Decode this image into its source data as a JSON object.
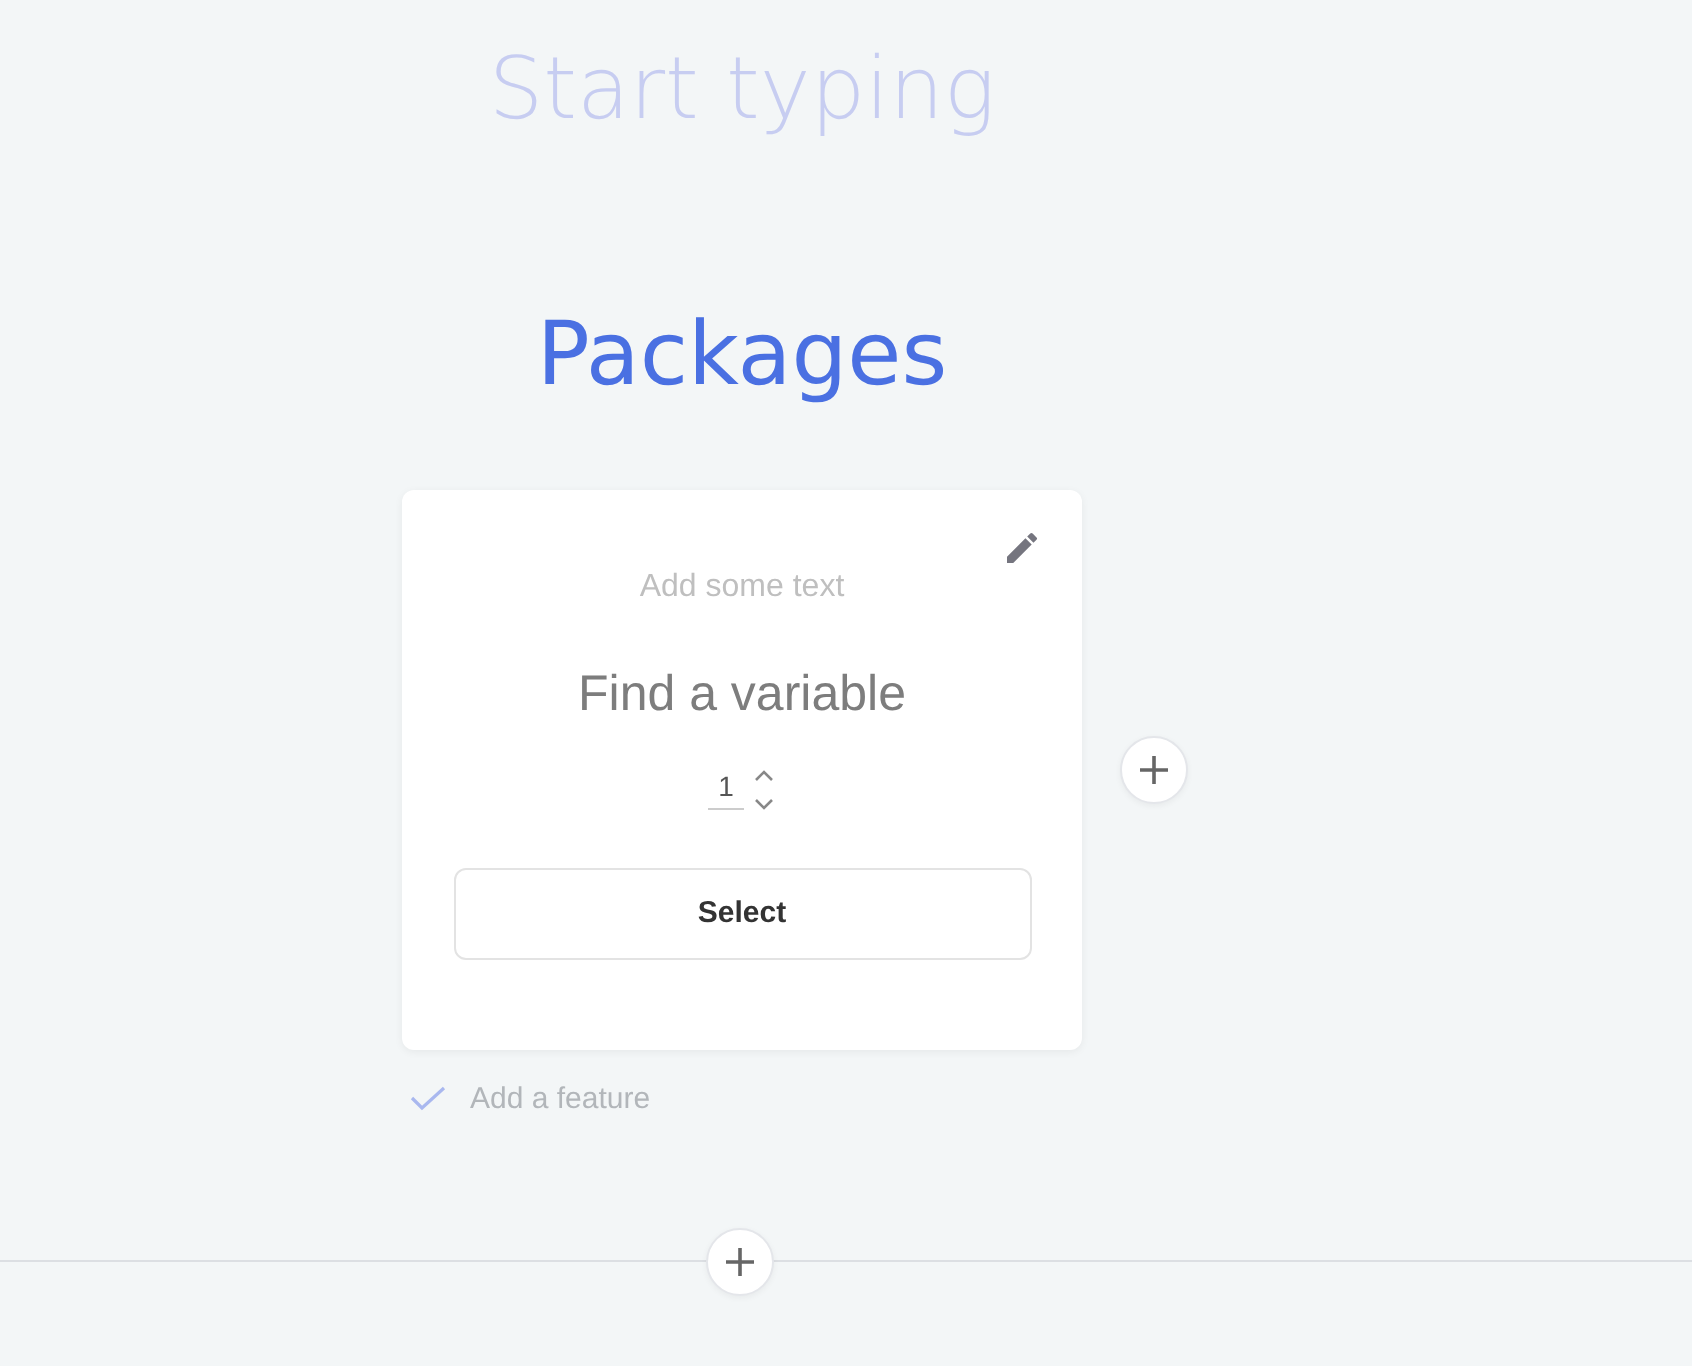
{
  "title": {
    "placeholder": "Start typing"
  },
  "heading": "Packages",
  "cards": [
    {
      "description": {
        "placeholder": "Add some text"
      },
      "name": {
        "placeholder": "Find a variable"
      },
      "quantity": "1",
      "button": "Select"
    }
  ],
  "feature": {
    "placeholder": "Add a feature"
  }
}
